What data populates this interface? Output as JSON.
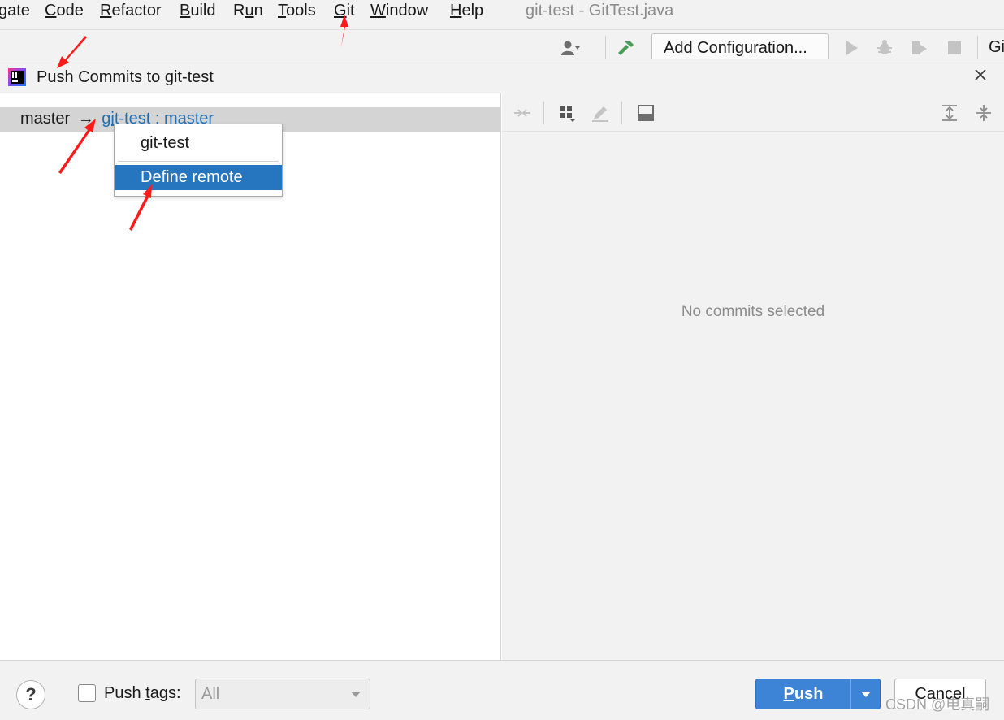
{
  "menubar": {
    "items": [
      {
        "label_mn": "",
        "label_rest": "gate"
      },
      {
        "label_mn": "C",
        "label_rest": "ode"
      },
      {
        "label_mn": "R",
        "label_rest": "efactor"
      },
      {
        "label_mn": "B",
        "label_rest": "uild"
      },
      {
        "label_mn": "",
        "label_rest": "Run",
        "mn_index": 1
      },
      {
        "label_mn": "T",
        "label_rest": "ools"
      },
      {
        "label_mn": "G",
        "label_rest": "it"
      },
      {
        "label_mn": "W",
        "label_rest": "indow"
      },
      {
        "label_mn": "H",
        "label_rest": "elp"
      }
    ],
    "window_title": "git-test - GitTest.java"
  },
  "toolbar": {
    "add_configuration": "Add Configuration...",
    "git_cut": "Gi"
  },
  "dialog": {
    "title": "Push Commits to git-test",
    "branch": {
      "local": "master",
      "arrow": "→",
      "remote": "git-test",
      "separator": " : ",
      "target": "master"
    },
    "popup": {
      "items": [
        "git-test",
        "Define remote"
      ],
      "selected": "Define remote"
    },
    "empty_message": "No commits selected",
    "footer": {
      "help": "?",
      "push_tags_mn": "t",
      "push_tags_before": "Push ",
      "push_tags_after": "ags:",
      "tags_value": "All",
      "push_mn": "P",
      "push_rest": "ush",
      "cancel": "Cancel"
    }
  },
  "watermark": "CSDN @电真嗣",
  "colors": {
    "accent": "#3d84d6",
    "selection": "#2675bf",
    "link": "#2470b3",
    "annotation_arrow": "#ff1a1a"
  }
}
